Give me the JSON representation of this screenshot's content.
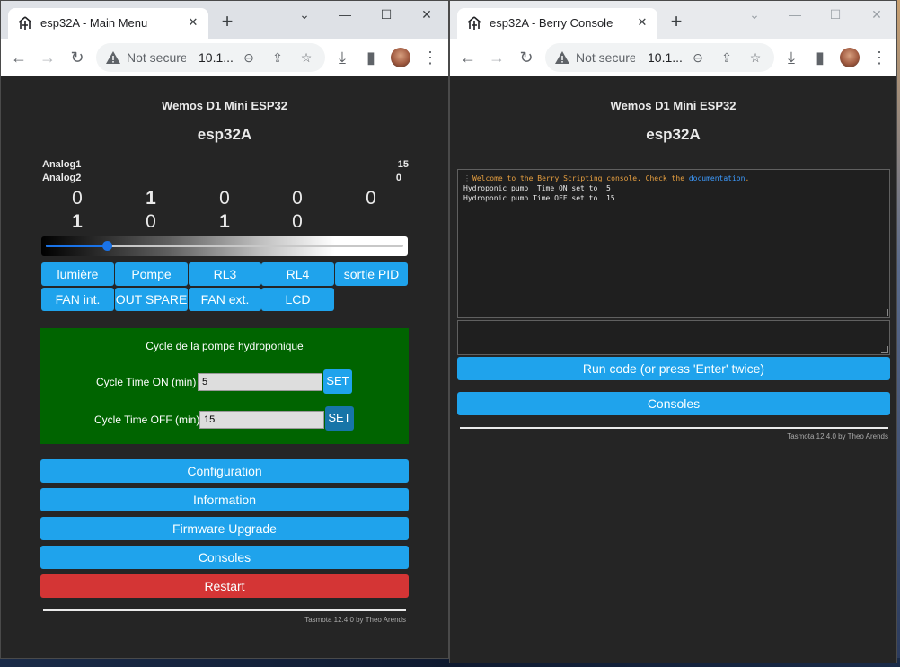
{
  "left_window": {
    "tab_title": "esp32A - Main Menu",
    "controls": {
      "minimize": "⌄",
      "restore": "—",
      "maximize": "☐",
      "close": "✕"
    },
    "omnibox": {
      "not_secure": "Not secure",
      "url": "10.1..."
    },
    "page": {
      "device_name": "Wemos D1 Mini ESP32",
      "hostname": "esp32A",
      "sensors": [
        {
          "label": "Analog1",
          "value": "15"
        },
        {
          "label": "Analog2",
          "value": "0"
        }
      ],
      "power_states_row1": [
        "0",
        "1",
        "0",
        "0",
        "0"
      ],
      "power_states_row2": [
        "1",
        "0",
        "1",
        "0"
      ],
      "dimmer_level_percent": 17,
      "relay_buttons": [
        "lumière",
        "Pompe",
        "RL3",
        "RL4",
        "sortie PID",
        "FAN int.",
        "OUT SPARE",
        "FAN ext.",
        "LCD"
      ],
      "pump": {
        "title": "Cycle de la pompe hydroponique",
        "on_label": "Cycle Time ON (min)",
        "on_value": "5",
        "off_label": "Cycle Time OFF (min)",
        "off_value": "15",
        "set_label": "SET"
      },
      "menu": {
        "configuration": "Configuration",
        "information": "Information",
        "firmware_upgrade": "Firmware Upgrade",
        "consoles": "Consoles",
        "restart": "Restart"
      },
      "footer": "Tasmota 12.4.0 by Theo Arends"
    }
  },
  "right_window": {
    "tab_title": "esp32A - Berry Console",
    "omnibox": {
      "not_secure": "Not secure",
      "url": "10.1..."
    },
    "page": {
      "device_name": "Wemos D1 Mini ESP32",
      "hostname": "esp32A",
      "console": {
        "welcome_prefix": "Welcome to the Berry Scripting console. Check the ",
        "welcome_link": "documentation",
        "welcome_suffix": ".",
        "lines": [
          "Hydroponic pump  Time ON set to  5",
          "Hydroponic pump Time OFF set to  15"
        ]
      },
      "run_button": "Run code (or press 'Enter' twice)",
      "consoles_button": "Consoles",
      "footer": "Tasmota 12.4.0 by Theo Arends"
    }
  },
  "colors": {
    "page_bg": "#252525",
    "button_blue": "#1fa3ec",
    "restart_red": "#d43535",
    "pump_box_green": "#006400",
    "console_welcome": "#e8a040",
    "console_link": "#3d9bff"
  },
  "icons": {
    "favicon": "tasmota-icon",
    "back": "arrow-left-icon",
    "forward": "arrow-right-icon",
    "reload": "reload-icon",
    "warning": "warning-triangle-icon",
    "zoom": "zoom-out-icon",
    "share": "share-icon",
    "bookmark": "star-icon",
    "download": "download-icon",
    "side_panel": "side-panel-icon",
    "menu": "kebab-menu-icon"
  }
}
